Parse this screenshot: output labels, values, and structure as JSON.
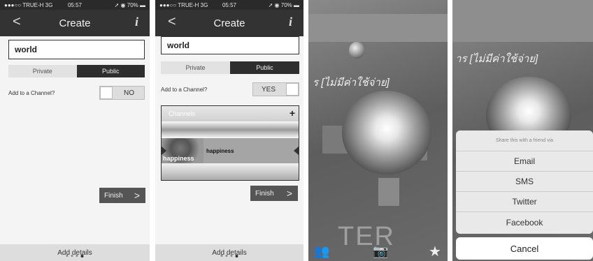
{
  "status": {
    "carrier": "●●●○○ TRUE-H  3G",
    "time": "05:57",
    "battery": "70%"
  },
  "nav": {
    "title": "Create",
    "info_glyph": "i"
  },
  "form": {
    "name_value": "world",
    "privacy_private": "Private",
    "privacy_public": "Public",
    "channel_question": "Add to a Channel?",
    "toggle_no": "NO",
    "toggle_yes": "YES",
    "finish_label": "Finish",
    "add_details": "Add details"
  },
  "channels": {
    "header": "Channels",
    "add_glyph": "+",
    "items": [
      {
        "name": "happiness",
        "thumb_text": "happiness"
      }
    ]
  },
  "ar": {
    "sign_text": "ร [ไม่มีค่าใช้จ่าย]",
    "sign_text_right": "าร [ไม่มีค่าใช้จ่าย]",
    "big_text": "TER"
  },
  "share": {
    "title": "Share this with a friend via",
    "options": [
      "Email",
      "SMS",
      "Twitter",
      "Facebook"
    ],
    "cancel": "Cancel"
  }
}
